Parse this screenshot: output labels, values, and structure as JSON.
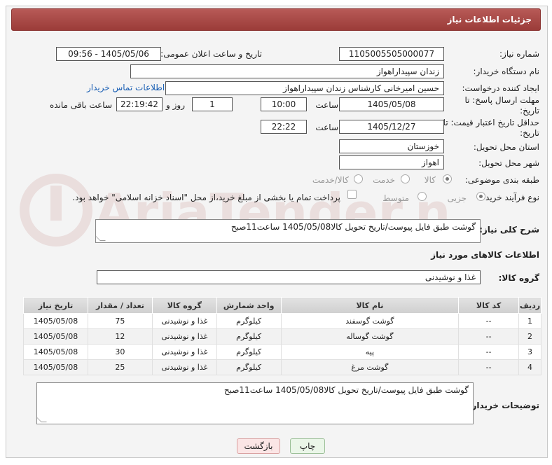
{
  "header": {
    "title": "جزئیات اطلاعات نیاز"
  },
  "fields": {
    "need_number_label": "شماره نیاز:",
    "need_number": "1105005505000077",
    "announce_label": "تاریخ و ساعت اعلان عمومی:",
    "announce_value": "1405/05/06 - 09:56",
    "buyer_org_label": "نام دستگاه خریدار:",
    "buyer_org": "زندان سپیداراهواز",
    "creator_label": "ایجاد کننده درخواست:",
    "creator": "حسین امیرخانی کارشناس زندان سپیداراهواز",
    "contact_link": "اطلاعات تماس خریدار",
    "deadline_label": "مهلت ارسال پاسخ: تا تاریخ:",
    "deadline_date": "1405/05/08",
    "time_label": "ساعت",
    "deadline_time": "10:00",
    "days_value": "1",
    "days_label": "روز و",
    "remaining_time": "22:19:42",
    "remaining_label": "ساعت باقی مانده",
    "min_valid_label": "حداقل تاریخ اعتبار قیمت: تا تاریخ:",
    "min_valid_date": "1405/12/27",
    "min_valid_time": "22:22",
    "province_label": "استان محل تحویل:",
    "province": "خوزستان",
    "city_label": "شهر محل تحویل:",
    "city": "اهواز",
    "category_label": "طبقه بندی موضوعی:",
    "category_options": [
      "کالا",
      "خدمت",
      "کالا/خدمت"
    ],
    "process_label": "نوع فرآیند خرید :",
    "process_options": [
      "جزیی",
      "متوسط"
    ],
    "payment_note": "پرداخت تمام یا بخشی از مبلغ خرید،از محل \"اسناد خزانه اسلامی\" خواهد بود.",
    "general_desc_label": "شرح کلی نیاز:",
    "general_desc": "گوشت طبق فایل پیوست/تاریخ تحویل کالا1405/05/08 ساعت11صبح",
    "goods_info_title": "اطلاعات کالاهای مورد نیاز",
    "goods_group_label": "گروه کالا:",
    "goods_group": "غذا و نوشیدنی",
    "buyer_notes_label": "توضیحات خریدار:",
    "buyer_notes": "گوشت طبق فایل پیوست/تاریخ تحویل کالا1405/05/08 ساعت11صبح"
  },
  "table": {
    "headers": [
      "ردیف",
      "کد کالا",
      "نام کالا",
      "واحد شمارش",
      "گروه کالا",
      "تعداد / مقدار",
      "تاریخ نیاز"
    ],
    "rows": [
      [
        "1",
        "--",
        "گوشت گوسفند",
        "کیلوگرم",
        "غذا و نوشیدنی",
        "75",
        "1405/05/08"
      ],
      [
        "2",
        "--",
        "گوشت گوساله",
        "کیلوگرم",
        "غذا و نوشیدنی",
        "12",
        "1405/05/08"
      ],
      [
        "3",
        "--",
        "پیه",
        "کیلوگرم",
        "غذا و نوشیدنی",
        "30",
        "1405/05/08"
      ],
      [
        "4",
        "--",
        "گوشت مرغ",
        "کیلوگرم",
        "غذا و نوشیدنی",
        "25",
        "1405/05/08"
      ]
    ]
  },
  "buttons": {
    "print": "چاپ",
    "back": "بازگشت"
  },
  "watermark": "AriaTender.net",
  "colors": {
    "header": "#a94442",
    "link": "#1a5fb4"
  }
}
